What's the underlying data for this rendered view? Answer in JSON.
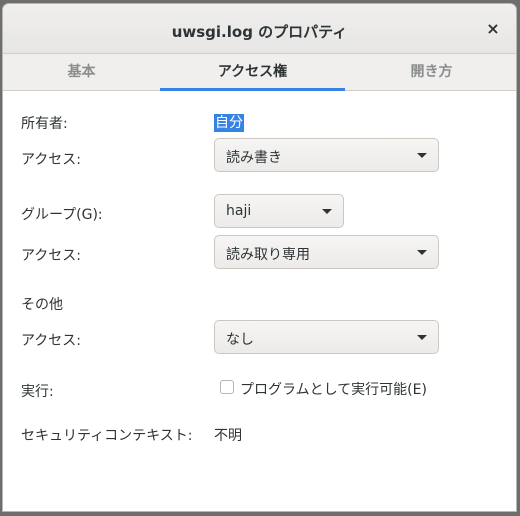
{
  "window": {
    "title": "uwsgi.log のプロパティ",
    "close_symbol": "×"
  },
  "tabs": [
    {
      "label": "基本",
      "active": false
    },
    {
      "label": "アクセス権",
      "active": true
    },
    {
      "label": "開き方",
      "active": false
    }
  ],
  "owner": {
    "label": "所有者:",
    "value": "自分",
    "access_label": "アクセス:",
    "access_value": "読み書き"
  },
  "group": {
    "label": "グループ(G):",
    "value": "haji",
    "access_label": "アクセス:",
    "access_value": "読み取り専用"
  },
  "others": {
    "label": "その他",
    "access_label": "アクセス:",
    "access_value": "なし"
  },
  "execute": {
    "label": "実行:",
    "checkbox_label": "プログラムとして実行可能(E)",
    "checked": false
  },
  "security": {
    "label": "セキュリティコンテキスト:",
    "value": "不明"
  },
  "colors": {
    "accent": "#3584e4",
    "text": "#2e3436",
    "tab_inactive": "#8a8e8d"
  },
  "icons": {
    "close": "close-icon",
    "dropdown": "chevron-down-icon"
  }
}
